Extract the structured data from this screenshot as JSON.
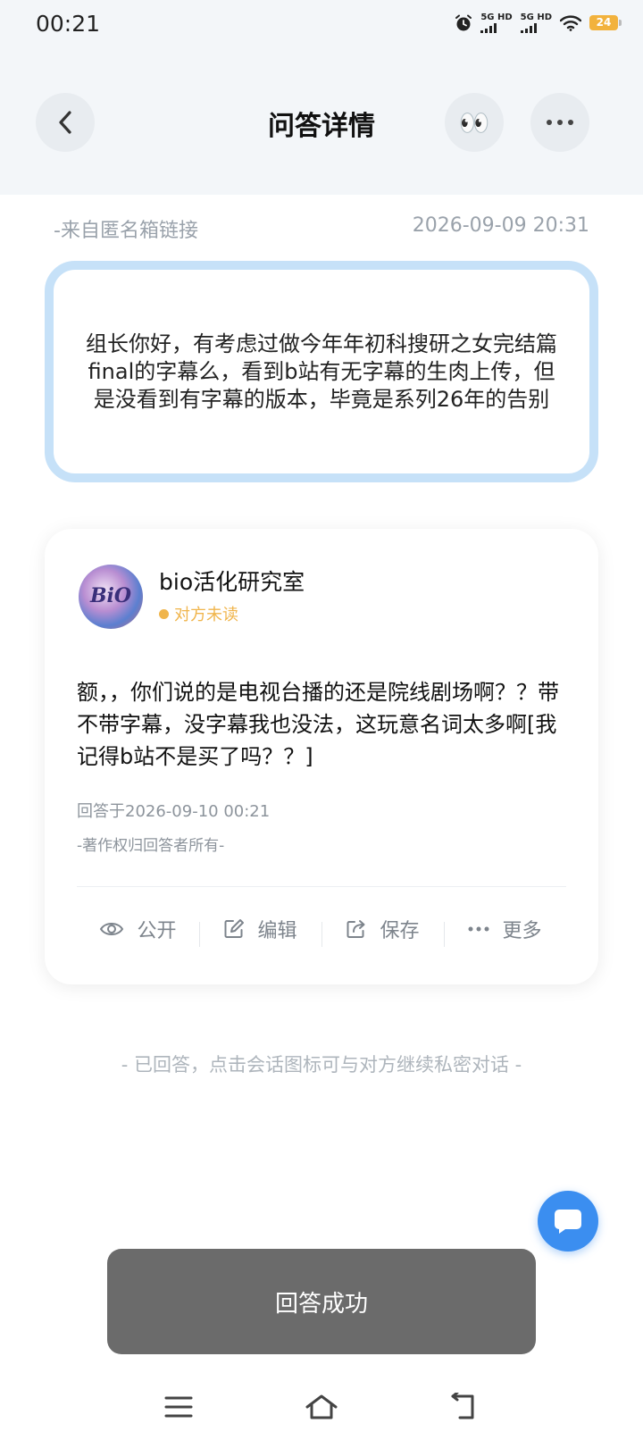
{
  "status_bar": {
    "time": "00:21",
    "sim1_label": "5G HD",
    "sim2_label": "5G HD",
    "battery_level": "24",
    "icons": [
      "alarm-icon",
      "signal-icon",
      "signal-icon",
      "wifi-icon",
      "battery-icon"
    ]
  },
  "header": {
    "title": "问答详情",
    "back_icon": "chevron-left-icon",
    "eyes_emoji": "👀",
    "more_icon": "more-horizontal-icon"
  },
  "question": {
    "source": "-来自匿名箱链接",
    "datetime": "2026-09-09 20:31",
    "text": "组长你好，有考虑过做今年年初科搜研之女完结篇final的字幕么，看到b站有无字幕的生肉上传，但是没看到有字幕的版本，毕竟是系列26年的告别",
    "border_color": "#c6e1f8"
  },
  "answer_card": {
    "avatar_text": "BiO",
    "username": "bio活化研究室",
    "read_status": "对方未读",
    "status_color": "#f0b54c",
    "text": "额，，你们说的是电视台播的还是院线剧场啊？？带不带字幕，没字幕我也没法，这玩意名词太多啊[我记得b站不是买了吗？？]",
    "answered_at": "回答于2026-09-10 00:21",
    "copyright": "-著作权归回答者所有-",
    "actions": [
      {
        "label": "公开",
        "icon": "eye-icon"
      },
      {
        "label": "编辑",
        "icon": "edit-icon"
      },
      {
        "label": "保存",
        "icon": "share-icon"
      },
      {
        "label": "更多",
        "icon": "more-horizontal-icon"
      }
    ]
  },
  "hint": "- 已回答，点击会话图标可与对方继续私密对话 -",
  "chat_button": {
    "icon": "chat-bubble-icon",
    "color": "#3b8ef0"
  },
  "toast": "回答成功",
  "bottom_nav": {
    "icons": [
      "menu-icon",
      "home-icon",
      "back-icon"
    ]
  }
}
